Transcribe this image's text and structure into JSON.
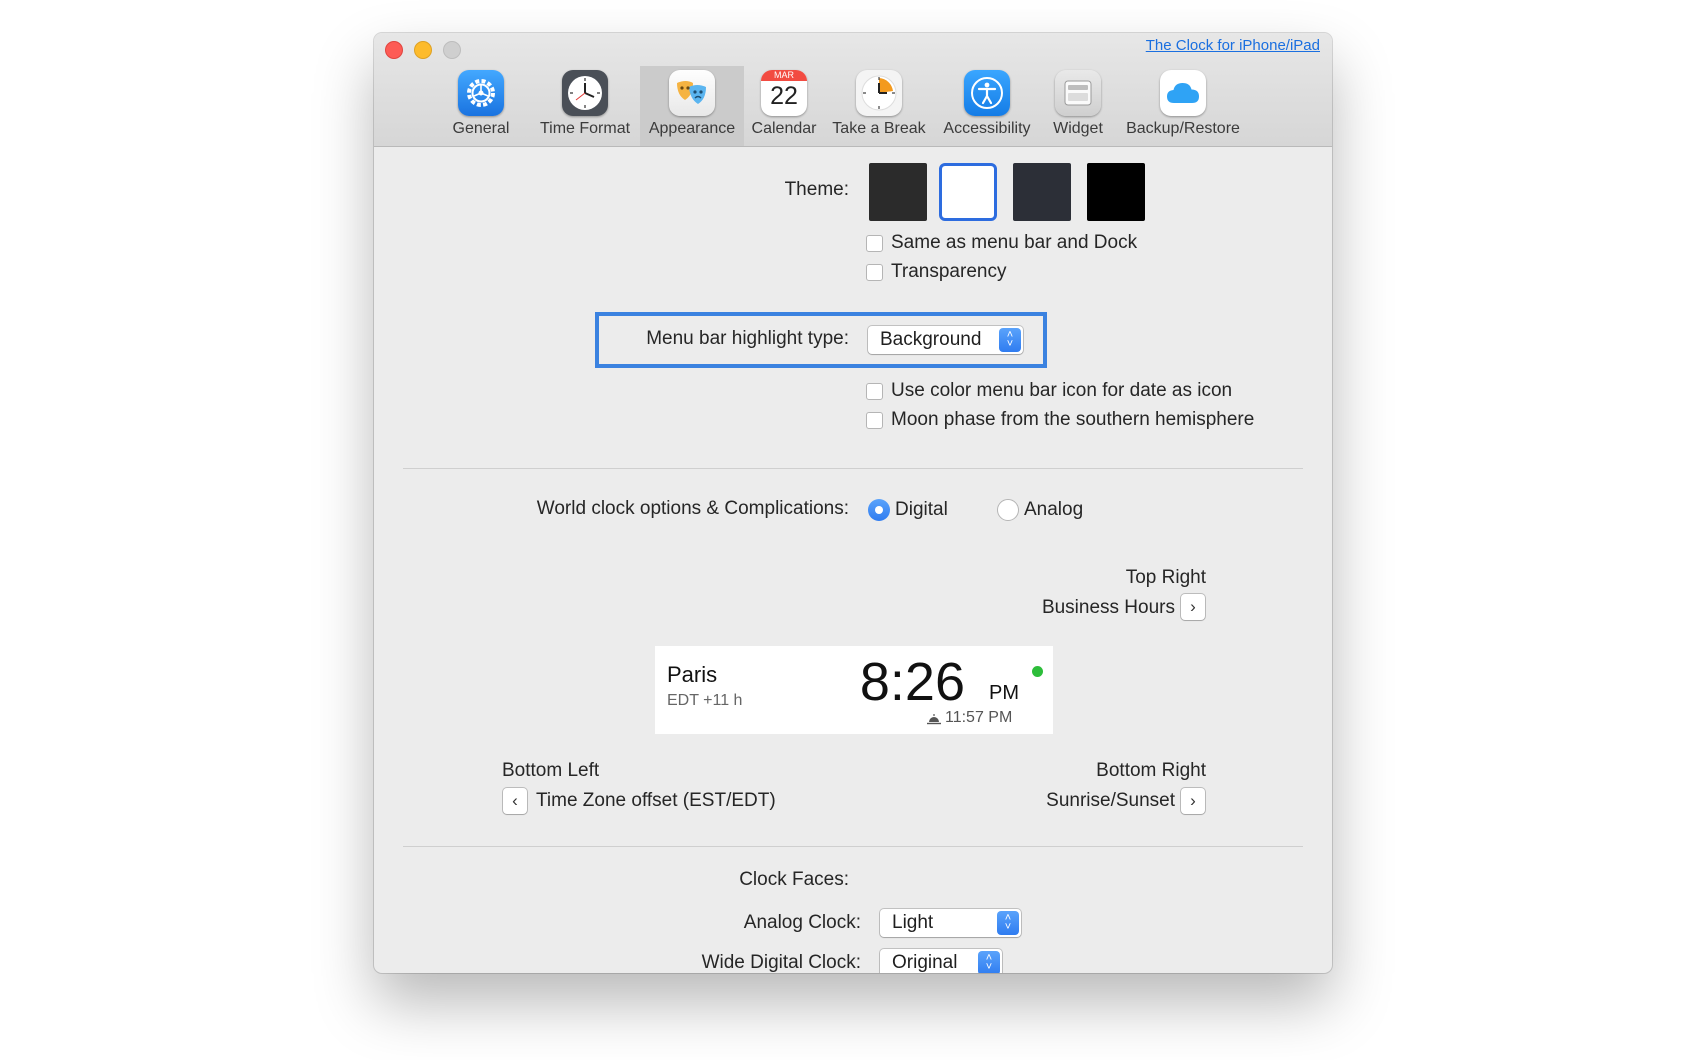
{
  "window": {
    "top_link": "The Clock for iPhone/iPad"
  },
  "toolbar": {
    "items": [
      {
        "label": "General",
        "icon": "gear-icon"
      },
      {
        "label": "Time Format",
        "icon": "clock-icon"
      },
      {
        "label": "Appearance",
        "icon": "theater-masks-icon",
        "selected": true
      },
      {
        "label": "Calendar",
        "icon": "calendar-icon",
        "month": "MAR",
        "day": "22"
      },
      {
        "label": "Take a Break",
        "icon": "timer-icon"
      },
      {
        "label": "Accessibility",
        "icon": "accessibility-icon"
      },
      {
        "label": "Widget",
        "icon": "widget-icon"
      },
      {
        "label": "Backup/Restore",
        "icon": "cloud-icon"
      }
    ]
  },
  "appearance": {
    "theme_label": "Theme:",
    "themes": [
      {
        "color": "#2b2b2b",
        "selected": false
      },
      {
        "color": "#ffffff",
        "selected": true
      },
      {
        "color": "#2c2f37",
        "selected": false
      },
      {
        "color": "#000000",
        "selected": false
      }
    ],
    "same_as_menubar": {
      "label": "Same as menu bar and Dock",
      "checked": false
    },
    "transparency": {
      "label": "Transparency",
      "checked": false
    },
    "highlight_type_label": "Menu bar highlight type:",
    "highlight_type_value": "Background",
    "color_menubar_icon": {
      "label": "Use color menu bar icon for date as icon",
      "checked": false
    },
    "moon_phase": {
      "label": "Moon phase from the southern hemisphere",
      "checked": false
    }
  },
  "world_clock": {
    "label": "World clock options & Complications:",
    "options": [
      {
        "label": "Digital",
        "selected": true
      },
      {
        "label": "Analog",
        "selected": false
      }
    ],
    "top_right_title": "Top Right",
    "top_right_value": "Business Hours",
    "preview": {
      "city": "Paris",
      "offset": "EDT +11 h",
      "time": "8:26",
      "ampm": "PM",
      "sunset": "11:57 PM",
      "status_color": "#2dbd3a"
    },
    "bottom_left_title": "Bottom Left",
    "bottom_left_value": "Time Zone offset (EST/EDT)",
    "bottom_right_title": "Bottom Right",
    "bottom_right_value": "Sunrise/Sunset"
  },
  "clock_faces": {
    "label": "Clock Faces:",
    "analog_label": "Analog Clock:",
    "analog_value": "Light",
    "wide_digital_label": "Wide Digital Clock:",
    "wide_digital_value": "Original"
  },
  "colors": {
    "accent": "#2f7cf0",
    "highlight_frame": "#3b82e0"
  }
}
